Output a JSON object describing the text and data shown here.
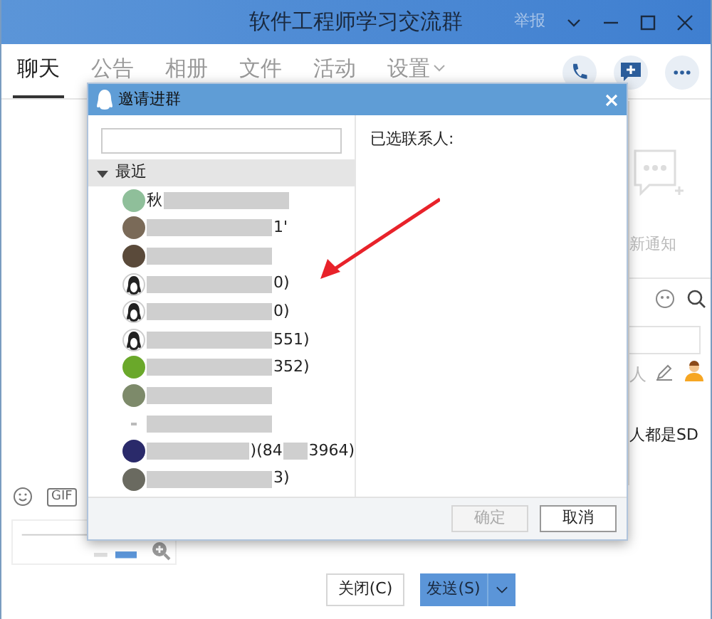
{
  "window": {
    "title": "软件工程师学习交流群",
    "report": "举报"
  },
  "tabs": [
    {
      "label": "聊天",
      "selected": true
    },
    {
      "label": "公告",
      "selected": false
    },
    {
      "label": "相册",
      "selected": false
    },
    {
      "label": "文件",
      "selected": false
    },
    {
      "label": "活动",
      "selected": false
    },
    {
      "label": "设置",
      "selected": false
    }
  ],
  "side_panel": {
    "notice": "新通知",
    "member_label": "人",
    "message": "人都是SD"
  },
  "composer": {
    "gif": "GIF",
    "close_button": "关闭(C)",
    "send_button": "发送(S)"
  },
  "dialog": {
    "title": "邀请进群",
    "group": {
      "label": "最近",
      "expanded": true
    },
    "contacts": [
      {
        "kind": "photo",
        "color": "#8fbf9a",
        "prefix": "秋"
      },
      {
        "kind": "photo",
        "color": "#7a6a58",
        "suffix": "1'"
      },
      {
        "kind": "photo",
        "color": "#5a4a3a"
      },
      {
        "kind": "penguin",
        "color": "#222222",
        "suffix": "0)"
      },
      {
        "kind": "penguin",
        "color": "#222222",
        "suffix": "0)"
      },
      {
        "kind": "penguin",
        "color": "#222222",
        "suffix": "551)"
      },
      {
        "kind": "photo",
        "color": "#6aa82a",
        "suffix": "352)"
      },
      {
        "kind": "photo",
        "color": "#7d8a6a"
      },
      {
        "kind": "mark",
        "color": "#bbbbbb"
      },
      {
        "kind": "photo",
        "color": "#2a2a6a",
        "suffix": ")(84",
        "suffix2": "3964)"
      },
      {
        "kind": "photo",
        "color": "#6a6a60",
        "suffix": "3)"
      }
    ],
    "selected_label": "已选联系人:",
    "ok_button": {
      "label": "确定",
      "disabled": true
    },
    "cancel_button": "取消"
  }
}
